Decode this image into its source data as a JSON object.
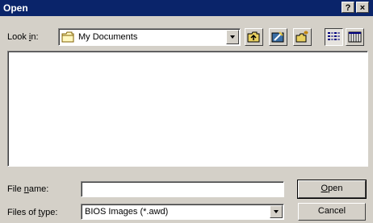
{
  "window": {
    "title": "Open",
    "help_glyph": "?",
    "close_glyph": "×"
  },
  "look_in": {
    "label_prefix": "Look ",
    "label_accel": "i",
    "label_suffix": "n:",
    "value": "My Documents",
    "icon": "folder-icon"
  },
  "toolbar": {
    "buttons": [
      {
        "name": "up-one-level",
        "icon": "up-folder-icon"
      },
      {
        "name": "desktop",
        "icon": "desktop-icon"
      },
      {
        "name": "new-folder",
        "icon": "new-folder-icon"
      },
      {
        "name": "list-view",
        "icon": "list-view-icon",
        "pressed": true
      },
      {
        "name": "details-view",
        "icon": "details-view-icon"
      }
    ]
  },
  "file_name": {
    "label_prefix": "File ",
    "label_accel": "n",
    "label_suffix": "ame:",
    "value": ""
  },
  "file_type": {
    "label_prefix": "Files of ",
    "label_accel": "t",
    "label_suffix": "ype:",
    "value": "BIOS Images (*.awd)"
  },
  "buttons": {
    "open_accel": "O",
    "open_rest": "pen",
    "cancel": "Cancel"
  },
  "colors": {
    "title_bar": "#0a246a",
    "face": "#d4d0c8"
  }
}
